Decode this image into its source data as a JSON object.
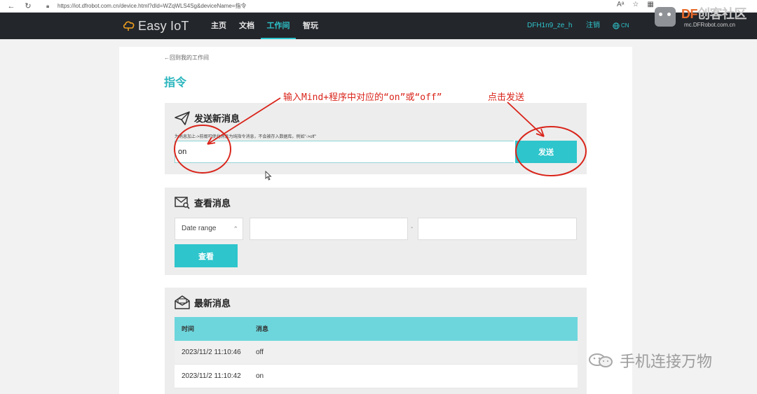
{
  "browser": {
    "url": "https://iot.dfrobot.com.cn/device.html?dId=WZqWLS4Sg&deviceName=指令"
  },
  "header": {
    "logo": "Easy IoT",
    "nav": [
      "主页",
      "文档",
      "工作间",
      "智玩"
    ],
    "active_nav": "工作间",
    "user": "DFH1n9_ze_h",
    "logout": "注销",
    "lang": "CN"
  },
  "watermark": {
    "brand_df": "DF",
    "brand_cn": "创客社区",
    "site": "mc.DFRobot.com.cn",
    "bottom": "手机连接万物"
  },
  "page": {
    "back_link": "←回到我的工作间",
    "title": "指令"
  },
  "send_panel": {
    "title": "发送新消息",
    "hint": "为消息加上->前缀可使此消息为纯指令消息，不会被存入数据库。例如\"->off\"",
    "input_value": "on",
    "send_label": "发送"
  },
  "view_panel": {
    "title": "查看消息",
    "date_range_label": "Date range",
    "start_date": "",
    "end_date": "",
    "dash": "-",
    "view_label": "查看"
  },
  "latest_panel": {
    "title": "最新消息",
    "columns": [
      "时间",
      "消息"
    ],
    "rows": [
      {
        "time": "2023/11/2 11:10:46",
        "msg": "off"
      },
      {
        "time": "2023/11/2 11:10:42",
        "msg": "on"
      }
    ]
  },
  "annotations": {
    "input_hint": "输入Mind+程序中对应的“on”或“off”",
    "send_hint": "点击发送"
  },
  "colors": {
    "accent": "#2ec5cc",
    "header_bg": "#23262b",
    "annotation": "#d9241a"
  }
}
